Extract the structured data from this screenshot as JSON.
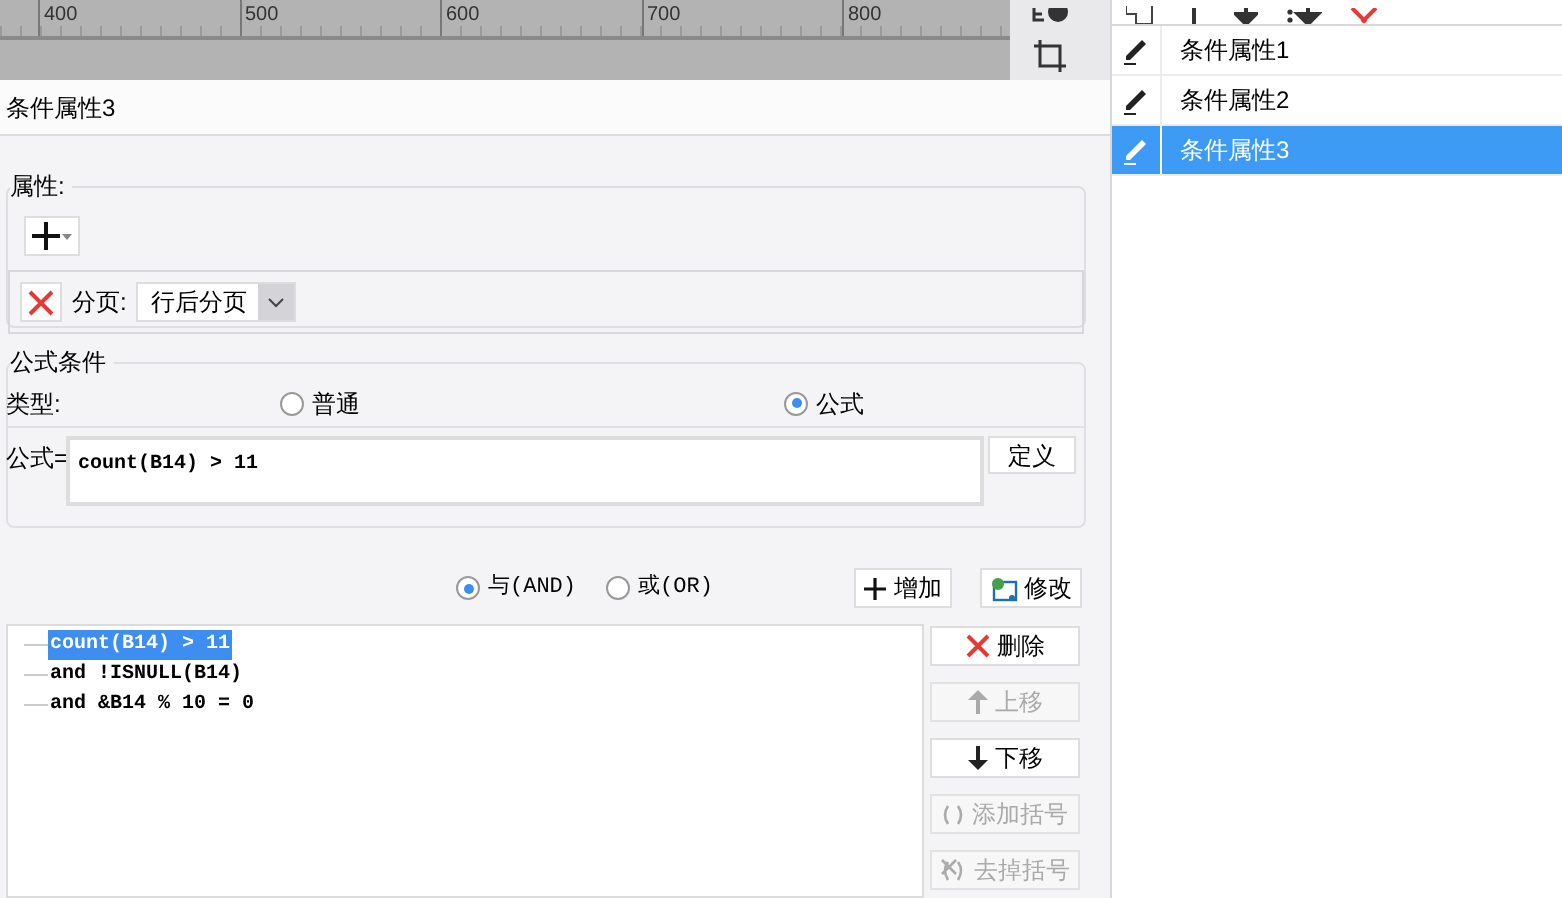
{
  "ruler": {
    "ticks": [
      "400",
      "500",
      "600",
      "700",
      "800"
    ]
  },
  "dialog": {
    "title": "条件属性3"
  },
  "properties": {
    "legend": "属性:",
    "page_break": {
      "label": "分页:",
      "value": "行后分页"
    }
  },
  "formula_condition": {
    "legend": "公式条件",
    "type_label": "类型:",
    "types": [
      {
        "label": "普通",
        "selected": false
      },
      {
        "label": "公式",
        "selected": true
      }
    ],
    "formula_label": "公式=",
    "formula_value": "count(B14) > 11",
    "define_button": "定义"
  },
  "logic": [
    {
      "label": "与(AND)",
      "selected": true
    },
    {
      "label": "或(OR)",
      "selected": false
    }
  ],
  "add_button": "增加",
  "modify_button": "修改",
  "conditions": [
    {
      "text": "count(B14) > 11",
      "selected": true
    },
    {
      "text": "and !ISNULL(B14)",
      "selected": false
    },
    {
      "text": "and &B14 % 10 = 0",
      "selected": false
    }
  ],
  "actions": [
    {
      "kind": "delete",
      "label": "删除",
      "disabled": false
    },
    {
      "kind": "up",
      "label": "上移",
      "disabled": true
    },
    {
      "kind": "down",
      "label": "下移",
      "disabled": false
    },
    {
      "kind": "add_paren",
      "label": "添加括号",
      "disabled": true
    },
    {
      "kind": "remove_paren",
      "label": "去掉括号",
      "disabled": true
    }
  ],
  "condition_list": [
    {
      "label": "条件属性1",
      "selected": false
    },
    {
      "label": "条件属性2",
      "selected": false
    },
    {
      "label": "条件属性3",
      "selected": true
    }
  ]
}
